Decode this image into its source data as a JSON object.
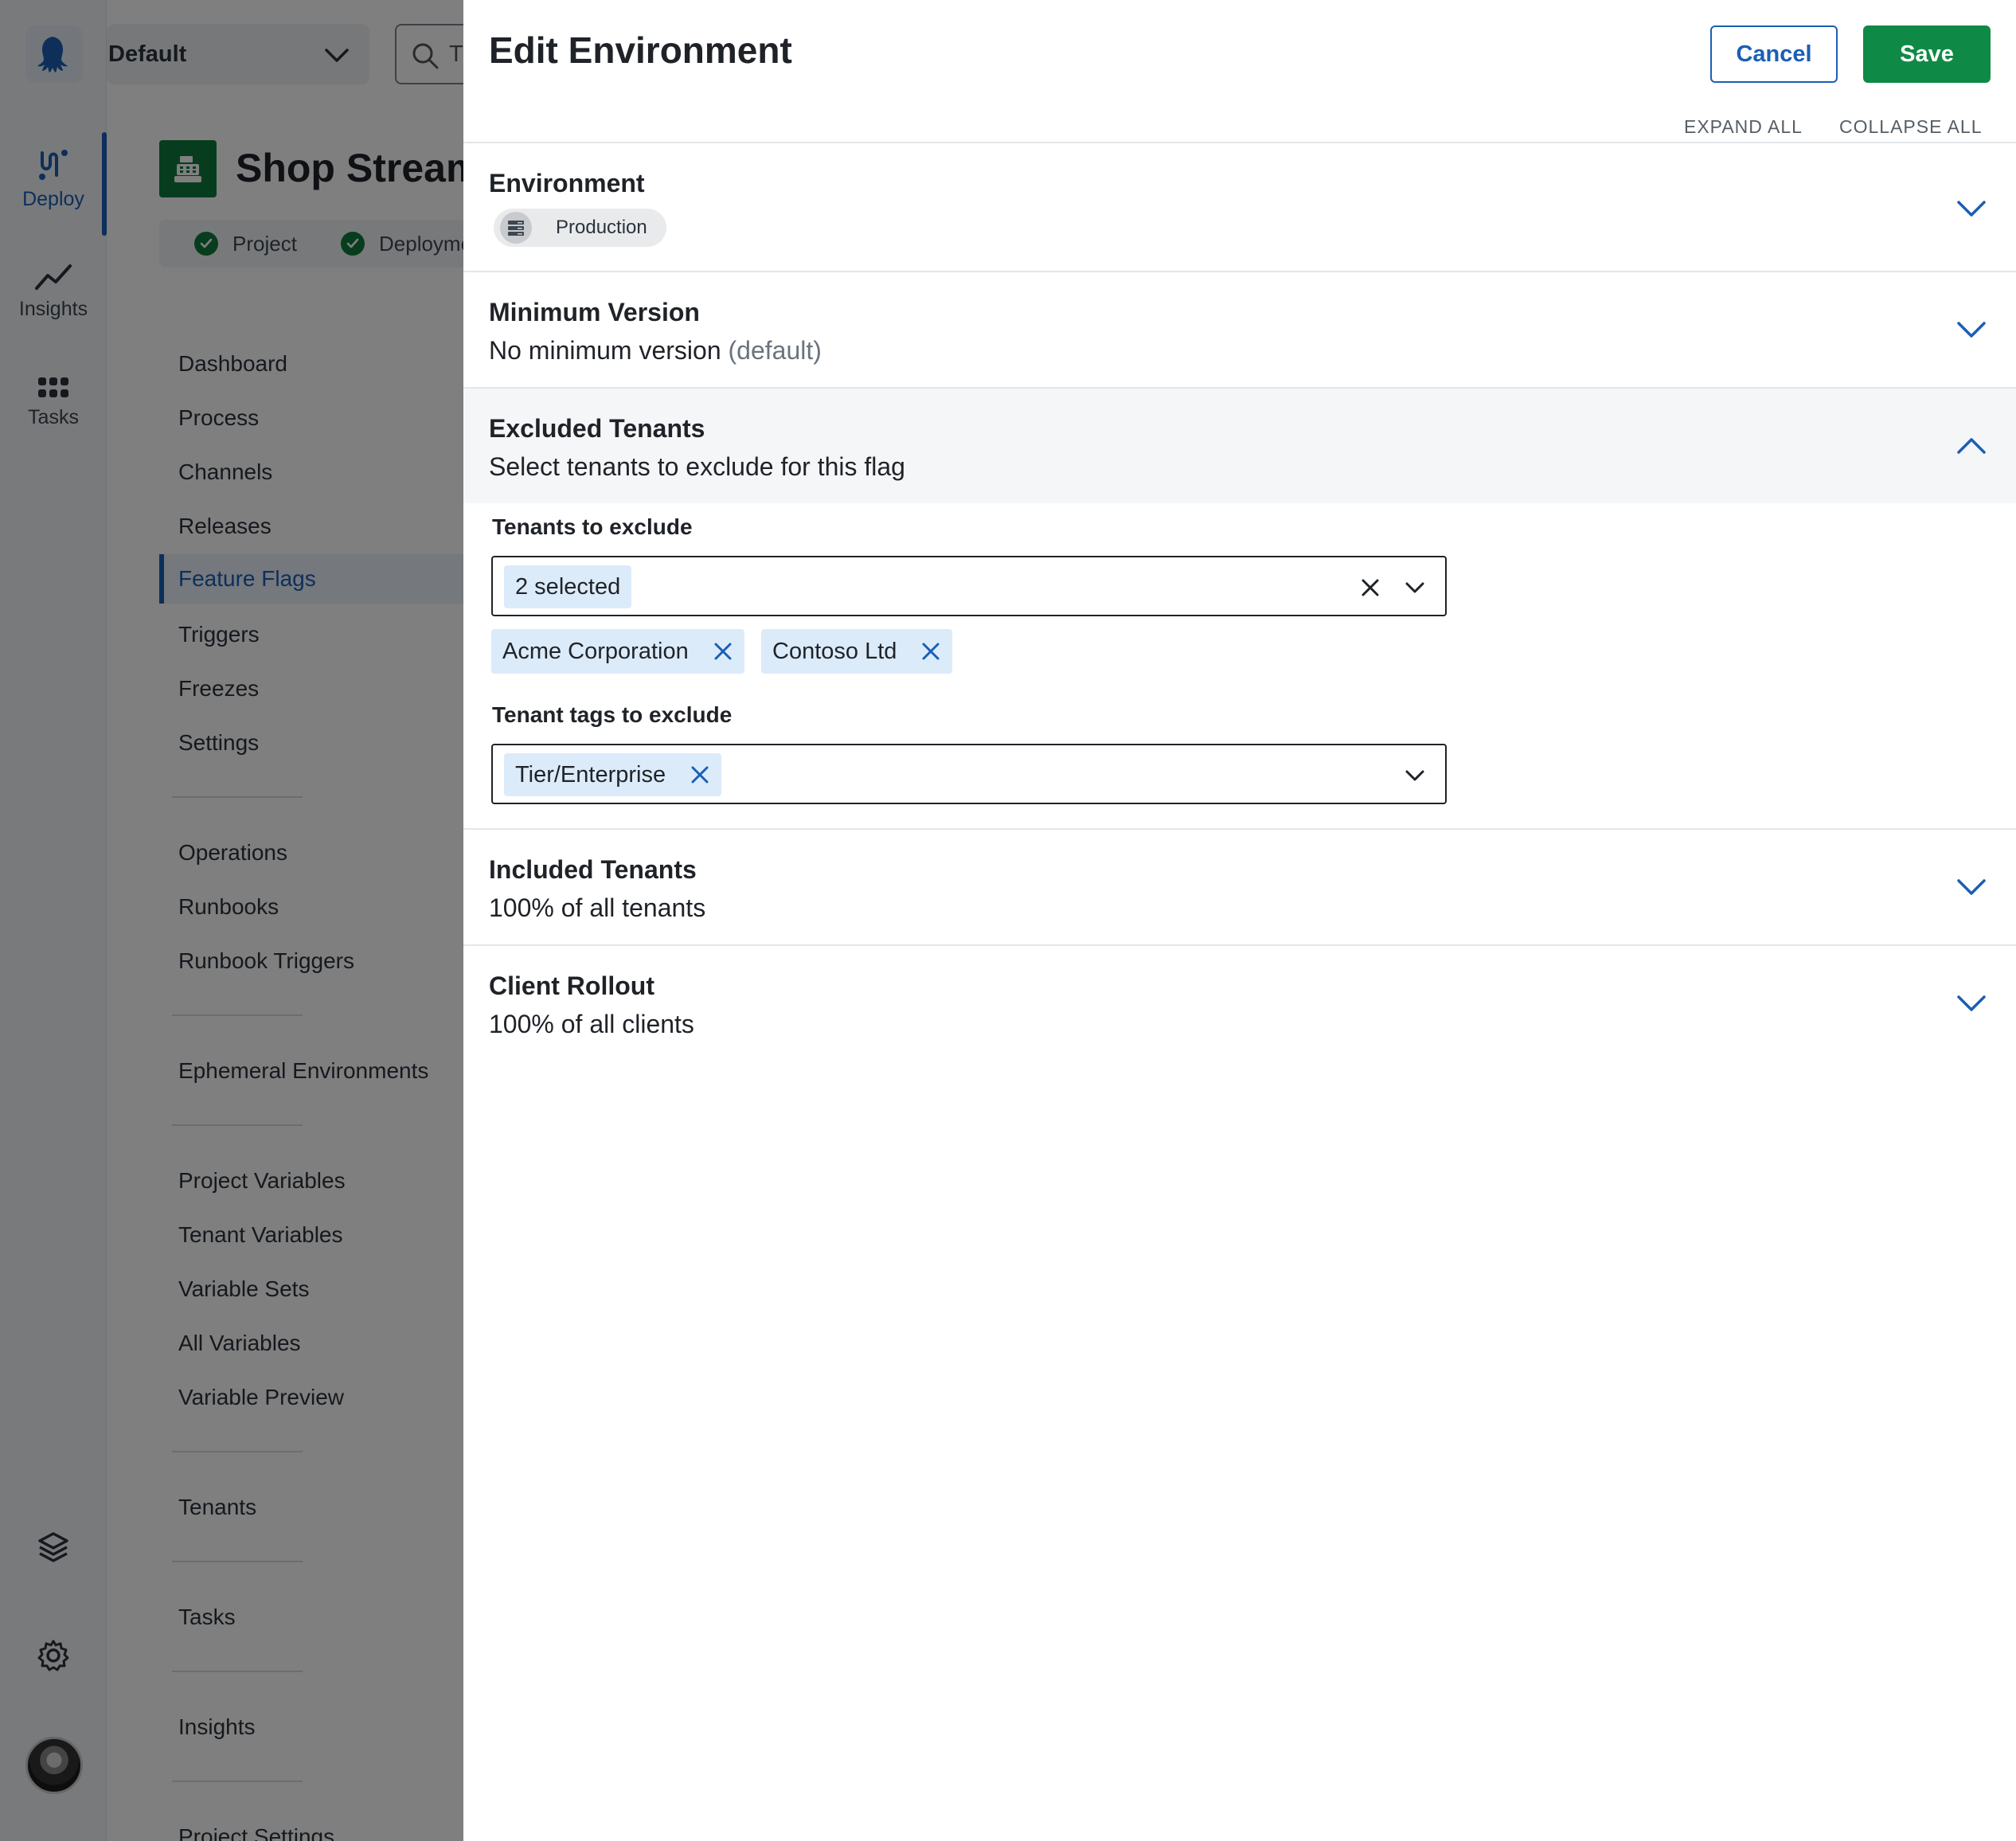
{
  "rail": {
    "items": [
      {
        "label": "Deploy"
      },
      {
        "label": "Insights"
      },
      {
        "label": "Tasks"
      }
    ]
  },
  "topbar": {
    "space": "Default",
    "search_placeholder": "T"
  },
  "project": {
    "name": "Shop Stream",
    "status": [
      {
        "label": "Project"
      },
      {
        "label": "Deployme"
      }
    ]
  },
  "nav": {
    "items": [
      {
        "label": "Dashboard"
      },
      {
        "label": "Process"
      },
      {
        "label": "Channels"
      },
      {
        "label": "Releases"
      },
      {
        "label": "Feature Flags"
      },
      {
        "label": "Triggers"
      },
      {
        "label": "Freezes"
      },
      {
        "label": "Settings"
      },
      {
        "label": "Operations"
      },
      {
        "label": "Runbooks"
      },
      {
        "label": "Runbook Triggers"
      },
      {
        "label": "Ephemeral Environments"
      },
      {
        "label": "Project Variables"
      },
      {
        "label": "Tenant Variables"
      },
      {
        "label": "Variable Sets"
      },
      {
        "label": "All Variables"
      },
      {
        "label": "Variable Preview"
      },
      {
        "label": "Tenants"
      },
      {
        "label": "Tasks"
      },
      {
        "label": "Insights"
      },
      {
        "label": "Project Settings"
      }
    ]
  },
  "drawer": {
    "title": "Edit Environment",
    "cancel_label": "Cancel",
    "save_label": "Save",
    "expand_all": "EXPAND ALL",
    "collapse_all": "COLLAPSE ALL",
    "sections": {
      "environment": {
        "title": "Environment",
        "chip": "Production"
      },
      "minimum_version": {
        "title": "Minimum Version",
        "summary": "No minimum version",
        "summary_muted": "(default)"
      },
      "excluded_tenants": {
        "title": "Excluded Tenants",
        "summary": "Select tenants to exclude for this flag",
        "tenants_label": "Tenants to exclude",
        "tenants_selected": "2 selected",
        "tenant_chips": [
          "Acme Corporation",
          "Contoso Ltd"
        ],
        "tags_label": "Tenant tags to exclude",
        "tag_chips": [
          "Tier/Enterprise"
        ]
      },
      "included_tenants": {
        "title": "Included Tenants",
        "summary": "100% of all tenants"
      },
      "client_rollout": {
        "title": "Client Rollout",
        "summary": "100% of all clients"
      }
    }
  },
  "colors": {
    "accent": "#1a5fb4",
    "save": "#0f8a46",
    "chip": "#dcebfa"
  }
}
